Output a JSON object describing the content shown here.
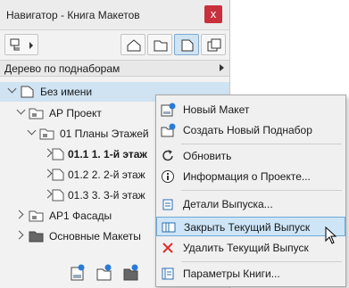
{
  "window": {
    "title": "Навигатор - Книга Макетов",
    "close_label": "x"
  },
  "combo": {
    "label": "Дерево по поднаборам"
  },
  "tree": [
    {
      "label": "Без имени",
      "bold": false
    },
    {
      "label": "АР Проект",
      "bold": false
    },
    {
      "label": "01 Планы Этажей",
      "bold": false
    },
    {
      "label": "01.1 1. 1-й этаж",
      "bold": true
    },
    {
      "label": "01.2 2. 2-й этаж",
      "bold": false
    },
    {
      "label": "01.3 3. 3-й этаж",
      "bold": false
    },
    {
      "label": "АР1 Фасады",
      "bold": false
    },
    {
      "label": "Основные Макеты",
      "bold": false
    }
  ],
  "context_menu": {
    "items": [
      {
        "label": "Новый Макет",
        "icon": "new-layout-icon"
      },
      {
        "label": "Создать Новый Поднабор",
        "icon": "new-subset-icon"
      },
      {
        "label": "Обновить",
        "icon": "refresh-icon"
      },
      {
        "label": "Информация о Проекте...",
        "icon": "info-icon"
      },
      {
        "label": "Детали Выпуска...",
        "icon": "issue-details-icon"
      },
      {
        "label": "Закрыть Текущий Выпуск",
        "icon": "close-issue-icon",
        "highlighted": true
      },
      {
        "label": "Удалить Текущий Выпуск",
        "icon": "delete-x-icon"
      },
      {
        "label": "Параметры Книги...",
        "icon": "book-settings-icon"
      }
    ]
  },
  "colors": {
    "selection": "#cfe3f2",
    "menu_highlight": "#cde5f7",
    "close_button": "#c8303c",
    "delete_icon": "#d9312b"
  }
}
